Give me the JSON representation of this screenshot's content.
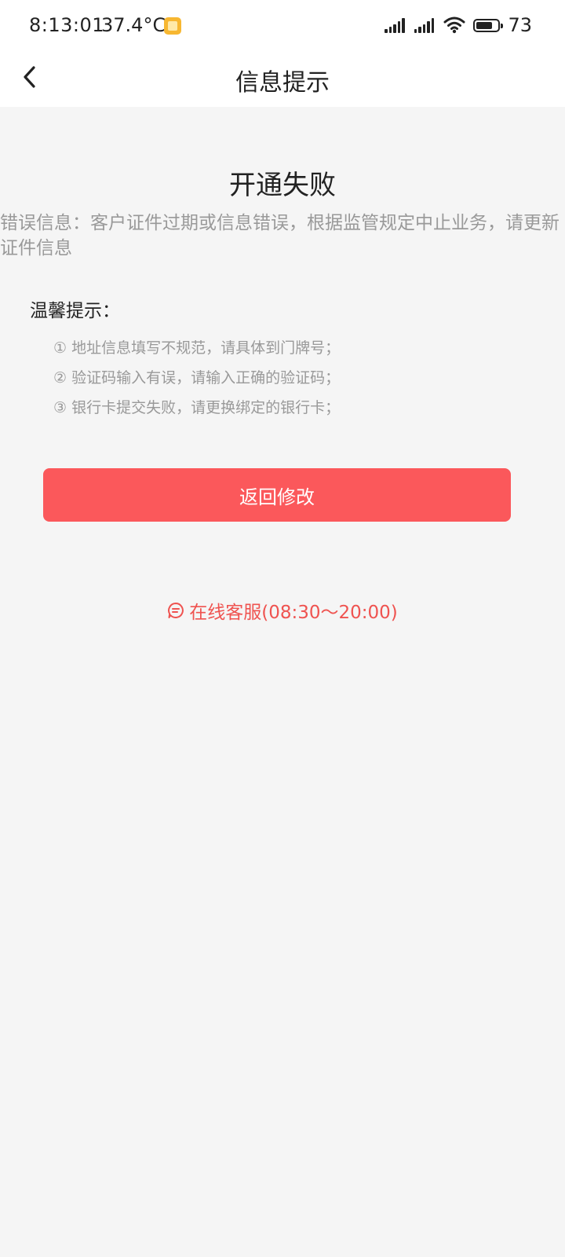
{
  "status_bar": {
    "time": "8:13:01",
    "temperature": "37.4°C",
    "battery": "73"
  },
  "nav": {
    "title": "信息提示"
  },
  "result": {
    "title": "开通失败",
    "error_message": "错误信息：客户证件过期或信息错误，根据监管规定中止业务，请更新证件信息"
  },
  "tips": {
    "title": "温馨提示：",
    "items": [
      "① 地址信息填写不规范，请具体到门牌号；",
      "② 验证码输入有误，请输入正确的验证码；",
      "③ 银行卡提交失败，请更换绑定的银行卡；"
    ]
  },
  "actions": {
    "primary_label": "返回修改",
    "service_label": "在线客服(08:30～20:00)"
  },
  "colors": {
    "accent": "#fb585b",
    "link": "#ef5350",
    "background": "#f5f5f5"
  },
  "icons": {
    "back": "chevron-left-icon",
    "service": "chat-bubble-icon"
  }
}
